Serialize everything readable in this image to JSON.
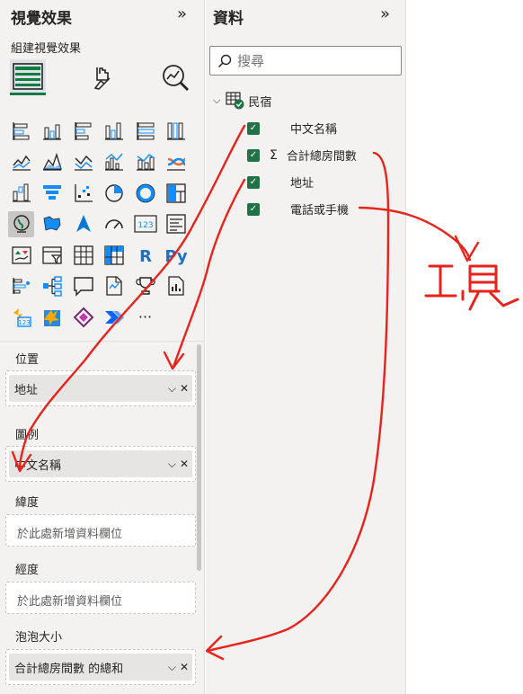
{
  "visualizations": {
    "title": "視覺效果",
    "build_label": "組建視覺效果",
    "collapse_icon": "double-chevron-right-icon",
    "tabs": [
      {
        "icon": "table-build-icon",
        "active": true
      },
      {
        "icon": "format-brush-icon",
        "active": false
      },
      {
        "icon": "analytics-magnifier-icon",
        "active": false
      }
    ],
    "visual_types": [
      "stacked-bar-icon",
      "stacked-column-icon",
      "clustered-bar-icon",
      "clustered-column-icon",
      "100-stacked-bar-icon",
      "100-stacked-column-icon",
      "line-chart-icon",
      "area-chart-icon",
      "stacked-area-icon",
      "line-clustered-column-icon",
      "line-stacked-column-icon",
      "ribbon-chart-icon",
      "waterfall-icon",
      "funnel-icon",
      "scatter-icon",
      "pie-icon",
      "donut-icon",
      "treemap-icon",
      "map-icon",
      "filled-map-icon",
      "azure-map-icon",
      "gauge-icon",
      "card-icon",
      "multi-row-card-icon",
      "kpi-icon",
      "slicer-icon",
      "table-icon",
      "matrix-icon",
      "r-visual-icon",
      "python-visual-icon",
      "key-influencers-icon",
      "decomposition-tree-icon",
      "qa-icon",
      "smart-narrative-icon",
      "trophy-metrics-icon",
      "paginated-report-icon",
      "power-apps-icon",
      "custom-visual-icon",
      "diamond-visual-icon",
      "power-automate-icon",
      "more-options-icon"
    ],
    "py_label": "Py",
    "r_label": "R",
    "card_label": "123",
    "more_label": "···",
    "wells": [
      {
        "label": "位置",
        "field": "地址",
        "placeholder": null
      },
      {
        "label": "圖例",
        "field": "中文名稱",
        "placeholder": null
      },
      {
        "label": "緯度",
        "field": null,
        "placeholder": "於此處新增資料欄位"
      },
      {
        "label": "經度",
        "field": null,
        "placeholder": "於此處新增資料欄位"
      },
      {
        "label": "泡泡大小",
        "field": "合計總房間數 的總和",
        "placeholder": null
      }
    ]
  },
  "data": {
    "title": "資料",
    "collapse_icon": "double-chevron-right-icon",
    "search_placeholder": "搜尋",
    "table_name": "民宿",
    "fields": [
      {
        "name": "中文名稱",
        "checked": true,
        "sigma": false
      },
      {
        "name": "合計總房間數",
        "checked": true,
        "sigma": true
      },
      {
        "name": "地址",
        "checked": true,
        "sigma": false
      },
      {
        "name": "電話或手機",
        "checked": true,
        "sigma": false
      }
    ],
    "sigma_symbol": "Σ",
    "pill_chevron": "⌵",
    "pill_close": "✕"
  },
  "annotation": {
    "color": "#e8231c",
    "handwritten_text": "工具"
  }
}
